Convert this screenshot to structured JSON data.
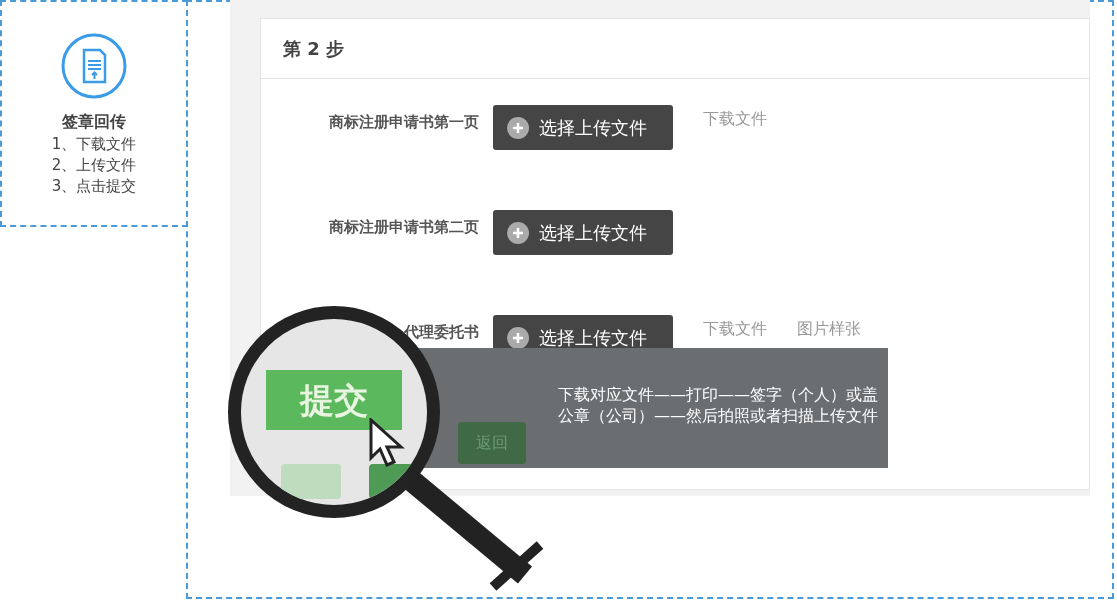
{
  "step_card": {
    "title": "签章回传",
    "steps": [
      "1、下载文件",
      "2、上传文件",
      "3、点击提交"
    ]
  },
  "form": {
    "header": "第 2 步",
    "rows": [
      {
        "label": "商标注册申请书第一页",
        "button": "选择上传文件",
        "links": [
          "下载文件"
        ]
      },
      {
        "label": "商标注册申请书第二页",
        "button": "选择上传文件",
        "links": []
      },
      {
        "label": "代理委托书",
        "button": "选择上传文件",
        "links": [
          "下载文件",
          "图片样张"
        ]
      }
    ],
    "back_button": "返回"
  },
  "tip": {
    "lines": [
      "下载对应文件——打印——签字（个人）或盖",
      "公章（公司）——然后拍照或者扫描上传文件"
    ]
  },
  "magnifier": {
    "button": "提交"
  }
}
